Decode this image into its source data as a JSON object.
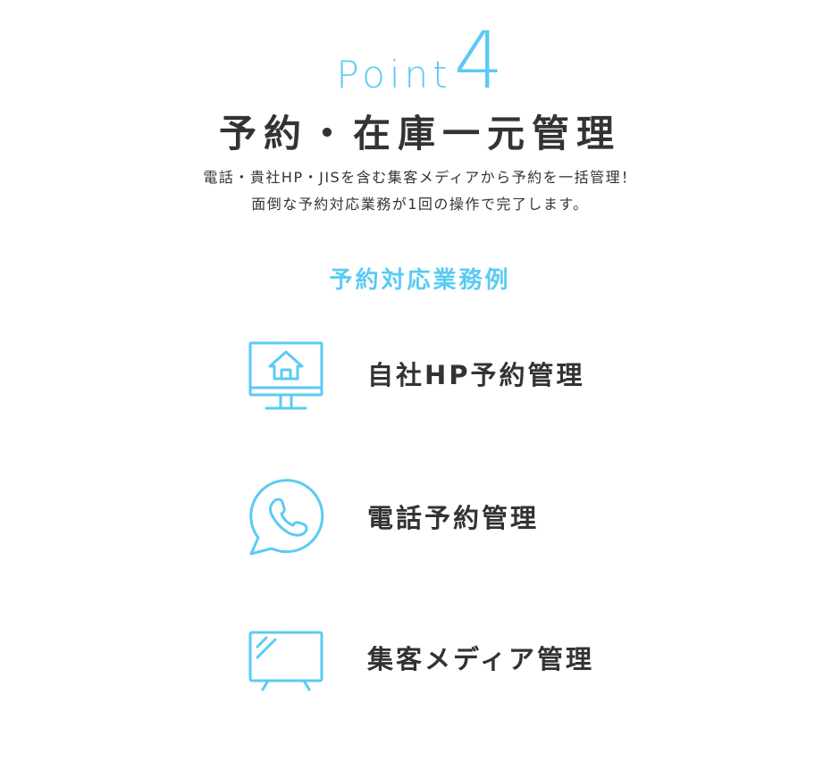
{
  "header": {
    "point_word": "Point",
    "point_number": "4",
    "title": "予約・在庫一元管理",
    "description_line1": "電話・貴社HP・JISを含む集客メディアから予約を一括管理！",
    "description_line2": "面倒な予約対応業務が1回の操作で完了します。"
  },
  "section": {
    "heading": "予約対応業務例",
    "items": [
      {
        "label": "自社HP予約管理",
        "icon": "monitor-home-icon"
      },
      {
        "label": "電話予約管理",
        "icon": "phone-bubble-icon"
      },
      {
        "label": "集客メディア管理",
        "icon": "tv-screen-icon"
      }
    ]
  },
  "colors": {
    "accent": "#5bcbf3",
    "text": "#333333",
    "background": "#ffffff"
  }
}
